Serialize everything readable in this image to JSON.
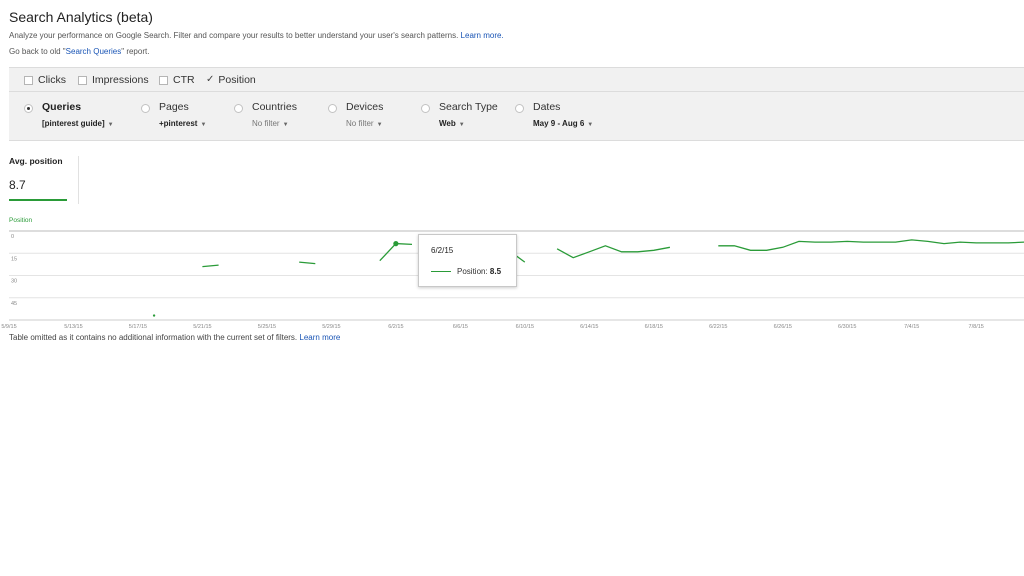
{
  "header": {
    "title": "Search Analytics (beta)",
    "subtitle": "Analyze your performance on Google Search. Filter and compare your results to better understand your user's search patterns.",
    "learn_more": "Learn more.",
    "back_prefix": "Go back to old \"",
    "back_link": "Search Queries",
    "back_suffix": "\" report."
  },
  "metrics": [
    {
      "label": "Clicks",
      "checked": false
    },
    {
      "label": "Impressions",
      "checked": false
    },
    {
      "label": "CTR",
      "checked": false
    },
    {
      "label": "Position",
      "checked": true
    }
  ],
  "filters": [
    {
      "label": "Queries",
      "value": "[pinterest guide]",
      "selected": true
    },
    {
      "label": "Pages",
      "value": "+pinterest",
      "selected": false
    },
    {
      "label": "Countries",
      "value": "No filter",
      "selected": false
    },
    {
      "label": "Devices",
      "value": "No filter",
      "selected": false
    },
    {
      "label": "Search Type",
      "value": "Web",
      "selected": false
    },
    {
      "label": "Dates",
      "value": "May 9 - Aug 6",
      "selected": false
    }
  ],
  "summary": {
    "label": "Avg. position",
    "value": "8.7"
  },
  "tooltip": {
    "date": "6/2/15",
    "series": "Position:",
    "value": "8.5"
  },
  "note": {
    "text": "Table omitted as it contains no additional information with the current set of filters.",
    "link": "Learn more"
  },
  "colors": {
    "series": "#2a9b38",
    "link": "#1a55b5",
    "bar_bg": "#f1f1f1"
  },
  "chart_data": {
    "type": "line",
    "title": "Position",
    "ylim": [
      0,
      60
    ],
    "y_inverted": true,
    "y_ticks": [
      "0",
      "15",
      "30",
      "45"
    ],
    "x_ticks": [
      "5/9/15",
      "5/13/15",
      "5/17/15",
      "5/21/15",
      "5/25/15",
      "5/29/15",
      "6/2/15",
      "6/6/15",
      "6/10/15",
      "6/14/15",
      "6/18/15",
      "6/22/15",
      "6/26/15",
      "6/30/15",
      "7/4/15",
      "7/8/15"
    ],
    "x_start": "5/9/15",
    "series": [
      {
        "name": "Position",
        "segments": [
          [
            {
              "x": "5/18/15",
              "y": 57
            }
          ],
          [
            {
              "x": "5/21/15",
              "y": 24
            },
            {
              "x": "5/22/15",
              "y": 23
            }
          ],
          [
            {
              "x": "5/27/15",
              "y": 21
            },
            {
              "x": "5/28/15",
              "y": 22
            }
          ],
          [
            {
              "x": "6/1/15",
              "y": 20
            },
            {
              "x": "6/2/15",
              "y": 8.5
            },
            {
              "x": "6/3/15",
              "y": 9
            }
          ],
          [
            {
              "x": "6/9/15",
              "y": 13
            },
            {
              "x": "6/10/15",
              "y": 21
            }
          ],
          [
            {
              "x": "6/12/15",
              "y": 12
            },
            {
              "x": "6/13/15",
              "y": 18
            },
            {
              "x": "6/14/15",
              "y": 14
            },
            {
              "x": "6/15/15",
              "y": 10
            },
            {
              "x": "6/16/15",
              "y": 14
            },
            {
              "x": "6/17/15",
              "y": 14
            },
            {
              "x": "6/18/15",
              "y": 13
            },
            {
              "x": "6/19/15",
              "y": 11
            }
          ],
          [
            {
              "x": "6/22/15",
              "y": 10
            },
            {
              "x": "6/23/15",
              "y": 10
            },
            {
              "x": "6/24/15",
              "y": 13
            },
            {
              "x": "6/25/15",
              "y": 13
            },
            {
              "x": "6/26/15",
              "y": 11
            },
            {
              "x": "6/27/15",
              "y": 7
            },
            {
              "x": "6/28/15",
              "y": 7.5
            },
            {
              "x": "6/29/15",
              "y": 7.5
            },
            {
              "x": "6/30/15",
              "y": 7
            },
            {
              "x": "7/1/15",
              "y": 7.5
            },
            {
              "x": "7/2/15",
              "y": 7.5
            },
            {
              "x": "7/3/15",
              "y": 7.5
            },
            {
              "x": "7/4/15",
              "y": 6
            },
            {
              "x": "7/5/15",
              "y": 7
            },
            {
              "x": "7/6/15",
              "y": 8.5
            },
            {
              "x": "7/7/15",
              "y": 7.5
            },
            {
              "x": "7/8/15",
              "y": 8
            },
            {
              "x": "7/9/15",
              "y": 8
            },
            {
              "x": "7/10/15",
              "y": 8
            },
            {
              "x": "7/11/15",
              "y": 7.5
            }
          ]
        ]
      }
    ],
    "highlight": {
      "x": "6/2/15",
      "y": 8.5
    },
    "grid": true
  }
}
